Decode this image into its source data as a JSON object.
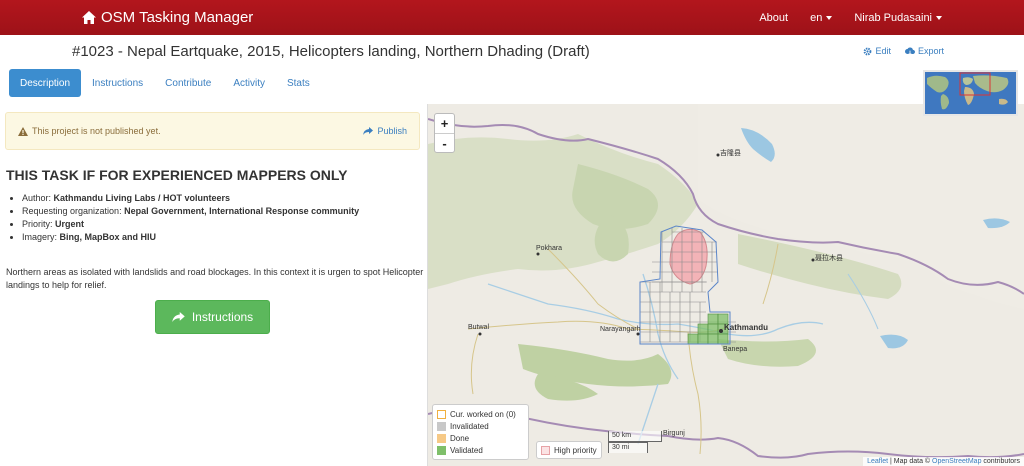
{
  "navbar": {
    "brand": "OSM Tasking Manager",
    "about": "About",
    "language": "en",
    "user": "Nirab Pudasaini"
  },
  "project": {
    "title": "#1023 - Nepal Eartquake, 2015, Helicopters landing, Northern Dhading (Draft)",
    "edit": "Edit",
    "export": "Export"
  },
  "tabs": [
    "Description",
    "Instructions",
    "Contribute",
    "Activity",
    "Stats"
  ],
  "alert": {
    "text": "This project is not published yet.",
    "publish": "Publish"
  },
  "description": {
    "heading": "THIS TASK IF FOR EXPERIENCED MAPPERS ONLY",
    "author_label": "Author:",
    "author": "Kathmandu Living Labs / HOT volunteers",
    "org_label": "Requesting organization:",
    "org": "Nepal Government, International Response community",
    "priority_label": "Priority:",
    "priority": "Urgent",
    "imagery_label": "Imagery:",
    "imagery": "Bing, MapBox and HIU",
    "body": "Northern areas as isolated with landslids and road blockages. In this context it is urgen to spot Helicopter landings to help for relief.",
    "button": "Instructions"
  },
  "map": {
    "zoom_in": "+",
    "zoom_out": "-",
    "legend": {
      "worked": "Cur. worked on (0)",
      "invalidated": "Invalidated",
      "done": "Done",
      "validated": "Validated"
    },
    "high_priority": "High priority",
    "scale_km": "50 km",
    "scale_mi": "30 mi",
    "attribution_leaflet": "Leaflet",
    "attribution_sep": " | Map data © ",
    "attribution_osm": "OpenStreetMap",
    "attribution_end": " contributors",
    "places": {
      "kathmandu": "Kathmandu",
      "pokhara": "Pokhara",
      "butwal": "Butwal",
      "narayangarh": "Narayangarh",
      "banepa": "Banepa",
      "birgunj": "Birgunj",
      "jilong": "吉隆县",
      "nyalam": "聂拉木县"
    },
    "colors": {
      "invalidated": "#c8c8c8",
      "done": "#f6c986",
      "validated": "#7fbf6a",
      "priority": "#f3b3b7"
    }
  }
}
